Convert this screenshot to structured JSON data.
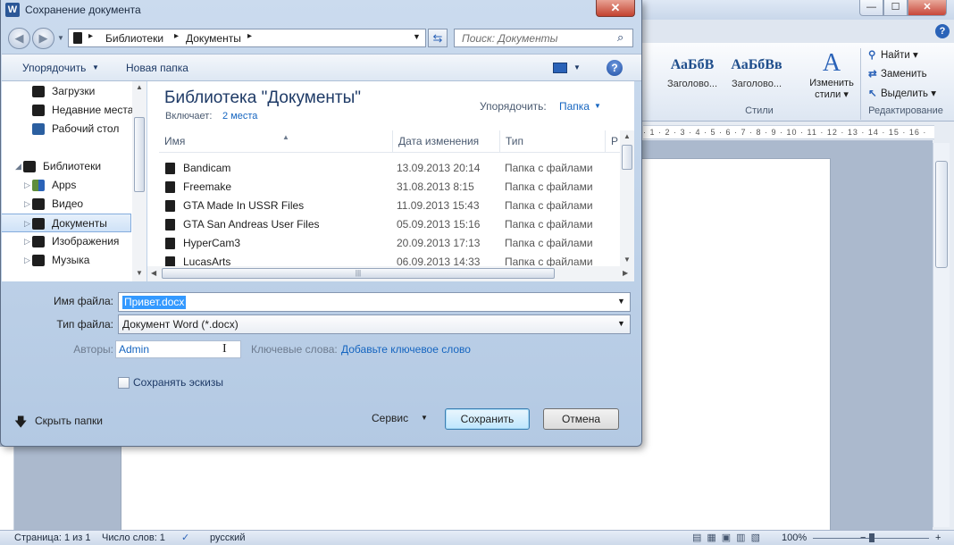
{
  "word": {
    "window_buttons": {
      "minimize": "—",
      "maximize": "☐",
      "close": "✕"
    },
    "help": "?",
    "styles": [
      {
        "sample": "АаБбВ",
        "name": "Заголово..."
      },
      {
        "sample": "АаБбВв",
        "name": "Заголово..."
      }
    ],
    "change_styles": {
      "icon": "A",
      "line1": "Изменить",
      "line2": "стили ▾"
    },
    "styles_group": "Стили",
    "editing": {
      "find": "Найти ▾",
      "replace": "Заменить",
      "select": "Выделить ▾",
      "group": "Редактирование"
    },
    "ruler_text": "· 1 · 2 · 3 · 4 · 5 · 6 · 7 · 8 · 9 · 10 · 11 · 12 · 13 · 14 · 15 · 16 ·",
    "status": {
      "page": "Страница: 1 из 1",
      "words": "Число слов: 1",
      "language": "русский",
      "zoom": "100%",
      "zoom_minus": "−",
      "zoom_plus": "+",
      "views": "▤▦▣▥▧"
    }
  },
  "dialog": {
    "app_icon": "W",
    "title": "Сохранение документа",
    "close": "✕",
    "breadcrumbs": [
      "Библиотеки",
      "Документы"
    ],
    "search_placeholder": "Поиск: Документы",
    "toolbar": {
      "organize": "Упорядочить",
      "new_folder": "Новая папка"
    },
    "nav_items": [
      {
        "label": "Загрузки",
        "expander": "",
        "icon": "folder-icon"
      },
      {
        "label": "Недавние места",
        "expander": "",
        "icon": "folder-icon"
      },
      {
        "label": "Рабочий стол",
        "expander": "",
        "icon": "desktop-icon"
      },
      {
        "label": "Библиотеки",
        "expander": "◢",
        "icon": "library-icon"
      },
      {
        "label": "Apps",
        "expander": "▷",
        "icon": "library-icon"
      },
      {
        "label": "Видео",
        "expander": "▷",
        "icon": "library-icon"
      },
      {
        "label": "Документы",
        "expander": "▷",
        "icon": "library-icon",
        "selected": true
      },
      {
        "label": "Изображения",
        "expander": "▷",
        "icon": "library-icon"
      },
      {
        "label": "Музыка",
        "expander": "▷",
        "icon": "library-icon"
      }
    ],
    "library": {
      "title": "Библиотека \"Документы\"",
      "includes_label": "Включает:",
      "includes_link": "2 места",
      "arrange_label": "Упорядочить:",
      "arrange_value": "Папка"
    },
    "columns": {
      "name": "Имя",
      "date": "Дата изменения",
      "type": "Тип",
      "size": "Р"
    },
    "files": [
      {
        "name": "Bandicam",
        "date": "13.09.2013 20:14",
        "type": "Папка с файлами"
      },
      {
        "name": "Freemake",
        "date": "31.08.2013 8:15",
        "type": "Папка с файлами"
      },
      {
        "name": "GTA Made In USSR Files",
        "date": "11.09.2013 15:43",
        "type": "Папка с файлами"
      },
      {
        "name": "GTA San Andreas User Files",
        "date": "05.09.2013 15:16",
        "type": "Папка с файлами"
      },
      {
        "name": "HyperCam3",
        "date": "20.09.2013 17:13",
        "type": "Папка с файлами"
      },
      {
        "name": "LucasArts",
        "date": "06.09.2013 14:33",
        "type": "Папка с файлами"
      }
    ],
    "form": {
      "filename_label": "Имя файла:",
      "filename_value": "Привет.docx",
      "filetype_label": "Тип файла:",
      "filetype_value": "Документ Word (*.docx)",
      "authors_label": "Авторы:",
      "authors_value": "Admin",
      "keywords_label": "Ключевые слова:",
      "keywords_link": "Добавьте ключевое слово",
      "thumbnails_label": "Сохранять эскизы",
      "thumbnails_checked": false
    },
    "footer": {
      "hide_folders": "Скрыть папки",
      "tools": "Сервис",
      "save": "Сохранить",
      "cancel": "Отмена"
    }
  }
}
